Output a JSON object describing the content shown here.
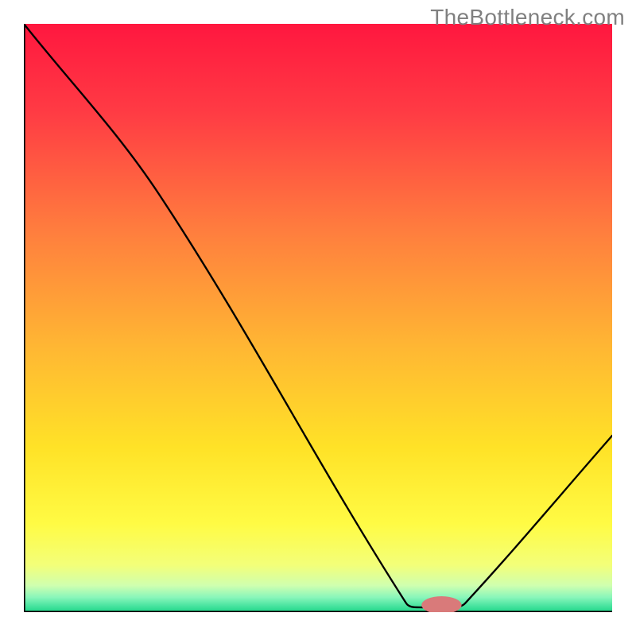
{
  "watermark": "TheBottleneck.com",
  "chart_data": {
    "type": "line",
    "title": "",
    "xlabel": "",
    "ylabel": "",
    "x_range": [
      0,
      100
    ],
    "y_range": [
      0,
      100
    ],
    "line_points": [
      {
        "x": 0,
        "y": 100
      },
      {
        "x": 23,
        "y": 71
      },
      {
        "x": 65,
        "y": 1.5
      },
      {
        "x": 68,
        "y": 0.8
      },
      {
        "x": 73,
        "y": 0.8
      },
      {
        "x": 75,
        "y": 1.5
      },
      {
        "x": 100,
        "y": 30
      }
    ],
    "marker": {
      "x": 71,
      "y": 1.2,
      "rx": 3.4,
      "ry": 1.5,
      "color": "#d97a7a"
    },
    "background_gradient_stops": [
      {
        "offset": 0.0,
        "color": "#ff173f"
      },
      {
        "offset": 0.15,
        "color": "#ff3b44"
      },
      {
        "offset": 0.35,
        "color": "#ff7d3e"
      },
      {
        "offset": 0.55,
        "color": "#ffb733"
      },
      {
        "offset": 0.72,
        "color": "#ffe227"
      },
      {
        "offset": 0.85,
        "color": "#fffb44"
      },
      {
        "offset": 0.92,
        "color": "#f3ff79"
      },
      {
        "offset": 0.955,
        "color": "#cfffb0"
      },
      {
        "offset": 0.975,
        "color": "#88f6ba"
      },
      {
        "offset": 0.99,
        "color": "#46e39e"
      },
      {
        "offset": 1.0,
        "color": "#21d688"
      }
    ],
    "axis_color": "#000000"
  }
}
